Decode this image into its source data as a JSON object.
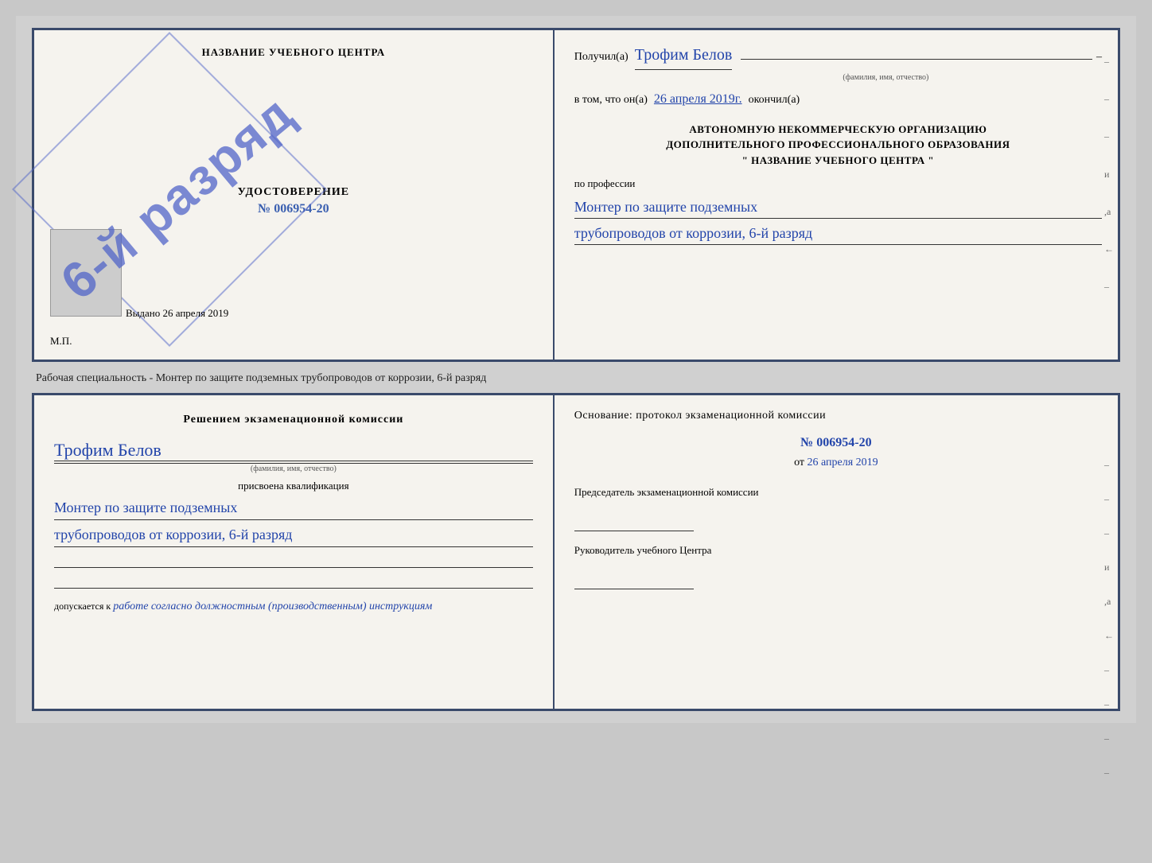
{
  "page": {
    "background": "#c8c8c8"
  },
  "top_doc": {
    "left": {
      "school_name": "НАЗВАНИЕ УЧЕБНОГО ЦЕНТРА",
      "stamp_text": "6-й разряд",
      "cert_title": "УДОСТОВЕРЕНИЕ",
      "cert_number": "№ 006954-20",
      "issued_label": "Выдано",
      "issued_date": "26 апреля 2019",
      "mp_label": "М.П."
    },
    "right": {
      "received_label": "Получил(а)",
      "recipient_name": "Трофим Белов",
      "recipient_subtext": "(фамилия, имя, отчество)",
      "dash": "–",
      "in_that_label": "в том, что он(а)",
      "completion_date": "26 апреля 2019г.",
      "completed_label": "окончил(а)",
      "org_line1": "АВТОНОМНУЮ НЕКОММЕРЧЕСКУЮ ОРГАНИЗАЦИЮ",
      "org_line2": "ДОПОЛНИТЕЛЬНОГО ПРОФЕССИОНАЛЬНОГО ОБРАЗОВАНИЯ",
      "org_line3": "\"  НАЗВАНИЕ УЧЕБНОГО ЦЕНТРА  \"",
      "profession_label": "по профессии",
      "profession_line1": "Монтер по защите подземных",
      "profession_line2": "трубопроводов от коррозии, 6-й разряд",
      "side_dashes": [
        "–",
        "–",
        "–",
        "и",
        ",а",
        "←",
        "–"
      ]
    }
  },
  "middle_text": "Рабочая специальность - Монтер по защите подземных трубопроводов от коррозии, 6-й разряд",
  "bottom_doc": {
    "left": {
      "decision_title": "Решением экзаменационной комиссии",
      "person_name": "Трофим Белов",
      "person_subtext": "(фамилия, имя, отчество)",
      "assigned_label": "присвоена квалификация",
      "qual_line1": "Монтер по защите подземных",
      "qual_line2": "трубопроводов от коррозии, 6-й разряд",
      "allowed_label": "допускается к",
      "allowed_text": "работе согласно должностным (производственным) инструкциям"
    },
    "right": {
      "basis_label": "Основание: протокол экзаменационной комиссии",
      "protocol_number": "№  006954-20",
      "date_prefix": "от",
      "protocol_date": "26 апреля 2019",
      "chairman_label": "Председатель экзаменационной комиссии",
      "director_label": "Руководитель учебного Центра",
      "side_dashes": [
        "–",
        "–",
        "–",
        "и",
        ",а",
        "←",
        "–",
        "–",
        "–",
        "–"
      ]
    }
  }
}
